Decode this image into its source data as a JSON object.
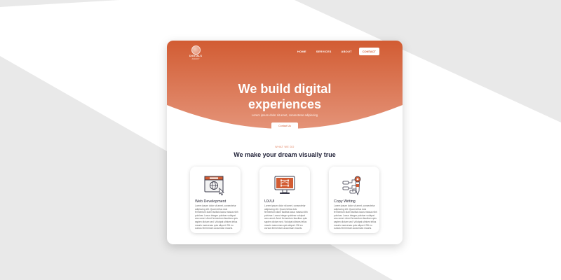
{
  "colors": {
    "accent": "#d25c33",
    "accent_light": "#e49378",
    "background": "#e9e9e9",
    "heading": "#23243a"
  },
  "brand": {
    "name": "DIGITALS",
    "tagline": "AGENCY"
  },
  "nav": {
    "items": [
      {
        "label": "HOME"
      },
      {
        "label": "SERVICES"
      },
      {
        "label": "ABOUT"
      }
    ],
    "contact_label": "CONTACT"
  },
  "hero": {
    "title_line1": "We build digital",
    "title_line2": "experiences",
    "subtitle": "Lorem ipsum dolor sit amet, consectetur adipiscing",
    "button_label": "Contact Us"
  },
  "section": {
    "eyebrow": "WHAT WE DO",
    "title": "We make your dream visually true"
  },
  "cards": [
    {
      "icon": "web-globe-icon",
      "title": "Web Development",
      "body": "Lorem ipsum dolor sit amet, consectetur adipiscing elit. Quam tellus duis fermentum diam facilisis lacus massa nibh pulvinar. Lacus integer pulvinar volutpat arcu amet. Amet fermentum faucibus quis sapien dictum sed. Volutpat ultrices tellus mauris maecenas quis aliquet. Elit eu cursus fermentum accumsan mauris."
    },
    {
      "icon": "monitor-design-icon",
      "title": "UX/UI",
      "body": "Lorem ipsum dolor sit amet, consectetur adipiscing elit. Quam tellus duis fermentum diam facilisis lacus massa nibh pulvinar. Lacus integer pulvinar volutpat arcu amet. Amet fermentum faucibus quis sapien dictum sed. Volutpat ultrices tellus mauris maecenas quis aliquet. Elit eu cursus fermentum accumsan mauris."
    },
    {
      "icon": "pen-flowchart-icon",
      "title": "Copy Writing",
      "body": "Lorem ipsum dolor sit amet, consectetur adipiscing elit. Quam tellus duis fermentum diam facilisis lacus massa nibh pulvinar. Lacus integer pulvinar volutpat arcu amet. Amet fermentum faucibus quis sapien dictum sed. Volutpat ultrices tellus mauris maecenas quis aliquet. Elit eu cursus fermentum accumsan mauris."
    }
  ]
}
